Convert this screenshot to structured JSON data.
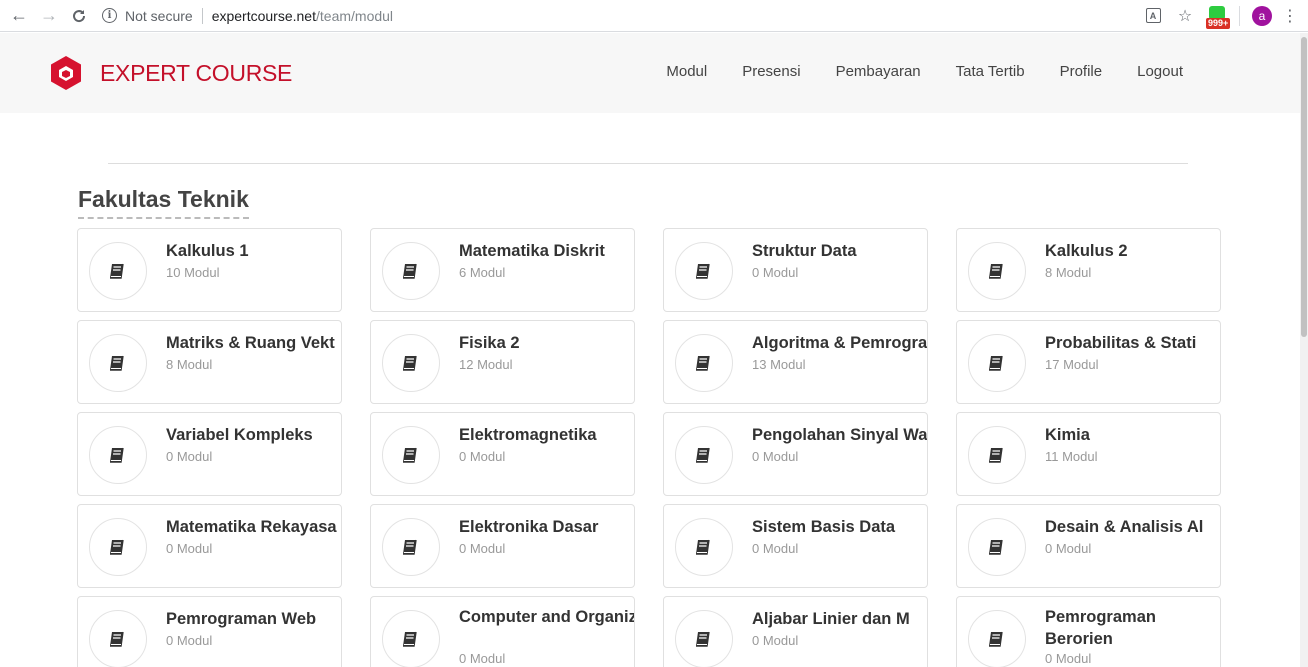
{
  "browser": {
    "security_text": "Not secure",
    "url_host": "expertcourse.net",
    "url_path": "/team/modul",
    "extension_badge": "999+",
    "avatar_letter": "a"
  },
  "site": {
    "brand": "EXPERT COURSE",
    "brand_color": "#c4102a",
    "nav": [
      "Modul",
      "Presensi",
      "Pembayaran",
      "Tata Tertib",
      "Profile",
      "Logout"
    ]
  },
  "section": {
    "title": "Fakultas Teknik",
    "courses": [
      {
        "title": "Kalkulus 1",
        "count": "10 Modul"
      },
      {
        "title": "Matematika Diskrit",
        "count": "6 Modul"
      },
      {
        "title": "Struktur Data",
        "count": "0 Modul"
      },
      {
        "title": "Kalkulus 2",
        "count": "8 Modul"
      },
      {
        "title": "Matriks & Ruang Vekt",
        "count": "8 Modul"
      },
      {
        "title": "Fisika 2",
        "count": "12 Modul"
      },
      {
        "title": "Algoritma & Pemrogra",
        "count": "13 Modul"
      },
      {
        "title": "Probabilitas & Stati",
        "count": "17 Modul"
      },
      {
        "title": "Variabel Kompleks",
        "count": "0 Modul"
      },
      {
        "title": "Elektromagnetika",
        "count": "0 Modul"
      },
      {
        "title": "Pengolahan Sinyal Wa",
        "count": "0 Modul"
      },
      {
        "title": "Kimia",
        "count": "11 Modul"
      },
      {
        "title": "Matematika Rekayasa",
        "count": "0 Modul"
      },
      {
        "title": "Elektronika Dasar",
        "count": "0 Modul"
      },
      {
        "title": "Sistem Basis Data",
        "count": "0 Modul"
      },
      {
        "title": "Desain & Analisis Al",
        "count": "0 Modul"
      },
      {
        "title": "Pemrograman Web",
        "count": "0 Modul"
      },
      {
        "title": "Computer and Organiz",
        "count": "0 Modul"
      },
      {
        "title": "Aljabar Linier dan M",
        "count": "0 Modul"
      },
      {
        "title": "Pemrograman Berorien",
        "count": "0 Modul"
      }
    ]
  }
}
